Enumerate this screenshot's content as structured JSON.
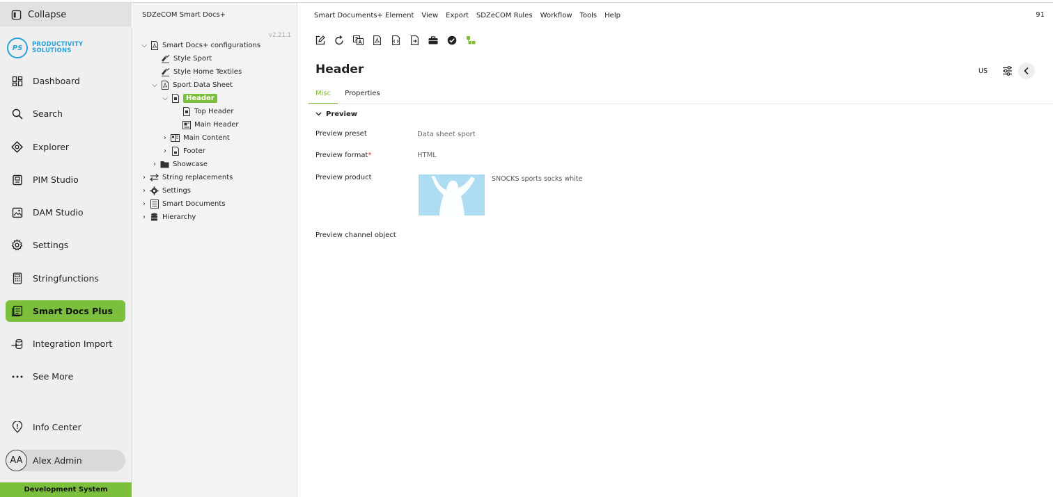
{
  "leftnav": {
    "collapse_label": "Collapse",
    "logo": {
      "mark": "PS",
      "line1": "PRODUCTIVITY",
      "line2": "SOLUTIONS",
      "brand_color": "#2aa3d9"
    },
    "items": [
      {
        "label": "Dashboard",
        "icon": "dashboard-icon"
      },
      {
        "label": "Search",
        "icon": "search-icon"
      },
      {
        "label": "Explorer",
        "icon": "explorer-icon"
      },
      {
        "label": "PIM Studio",
        "icon": "pim-studio-icon"
      },
      {
        "label": "DAM Studio",
        "icon": "image-icon"
      },
      {
        "label": "Settings",
        "icon": "gear-icon"
      },
      {
        "label": "Stringfunctions",
        "icon": "calculator-icon"
      },
      {
        "label": "Smart Docs Plus",
        "icon": "documents-icon",
        "active": true
      },
      {
        "label": "Integration Import",
        "icon": "import-icon"
      },
      {
        "label": "See More",
        "icon": "more-dots-icon"
      }
    ],
    "info_center": "Info Center",
    "user": {
      "initials": "AA",
      "name": "Alex Admin"
    },
    "environment": "Development System",
    "accent_color": "#7cbf3c"
  },
  "tree": {
    "title": "SDZeCOM Smart Docs+",
    "version": "v2.21.1",
    "nodes": [
      {
        "label": "Smart Docs+ configurations",
        "expanded": true
      },
      {
        "label": "Style Sport"
      },
      {
        "label": "Style Home Textiles"
      },
      {
        "label": "Sport Data Sheet",
        "expanded": true
      },
      {
        "label": "Header",
        "expanded": true,
        "selected": true
      },
      {
        "label": "Top Header"
      },
      {
        "label": "Main Header"
      },
      {
        "label": "Main Content",
        "expanded": false
      },
      {
        "label": "Footer",
        "expanded": false
      },
      {
        "label": "Showcase",
        "expanded": false
      },
      {
        "label": "String replacements",
        "expanded": false
      },
      {
        "label": "Settings",
        "expanded": false
      },
      {
        "label": "Smart Documents",
        "expanded": false
      },
      {
        "label": "Hierarchy",
        "expanded": false
      }
    ]
  },
  "main": {
    "menu": [
      "Smart Documents+ Element",
      "View",
      "Export",
      "SDZeCOM Rules",
      "Workflow",
      "Tools",
      "Help"
    ],
    "page_count": "91",
    "toolbar_icons": [
      "edit-icon",
      "reload-icon",
      "translate-icon",
      "pdf-icon",
      "html-preview-icon",
      "export-file-icon",
      "briefcase-icon",
      "check-circle-icon",
      "workflow-icon"
    ],
    "title": "Header",
    "locale": "US",
    "tabs": [
      {
        "label": "Misc",
        "active": true
      },
      {
        "label": "Properties"
      }
    ],
    "section": "Preview",
    "fields": {
      "preset": {
        "label": "Preview preset",
        "value": "Data sheet sport"
      },
      "format": {
        "label": "Preview format",
        "required_mark": "*",
        "value": "HTML"
      },
      "product": {
        "label": "Preview product",
        "value": "SNOCKS sports socks white"
      },
      "channel": {
        "label": "Preview channel object",
        "value": ""
      }
    }
  }
}
